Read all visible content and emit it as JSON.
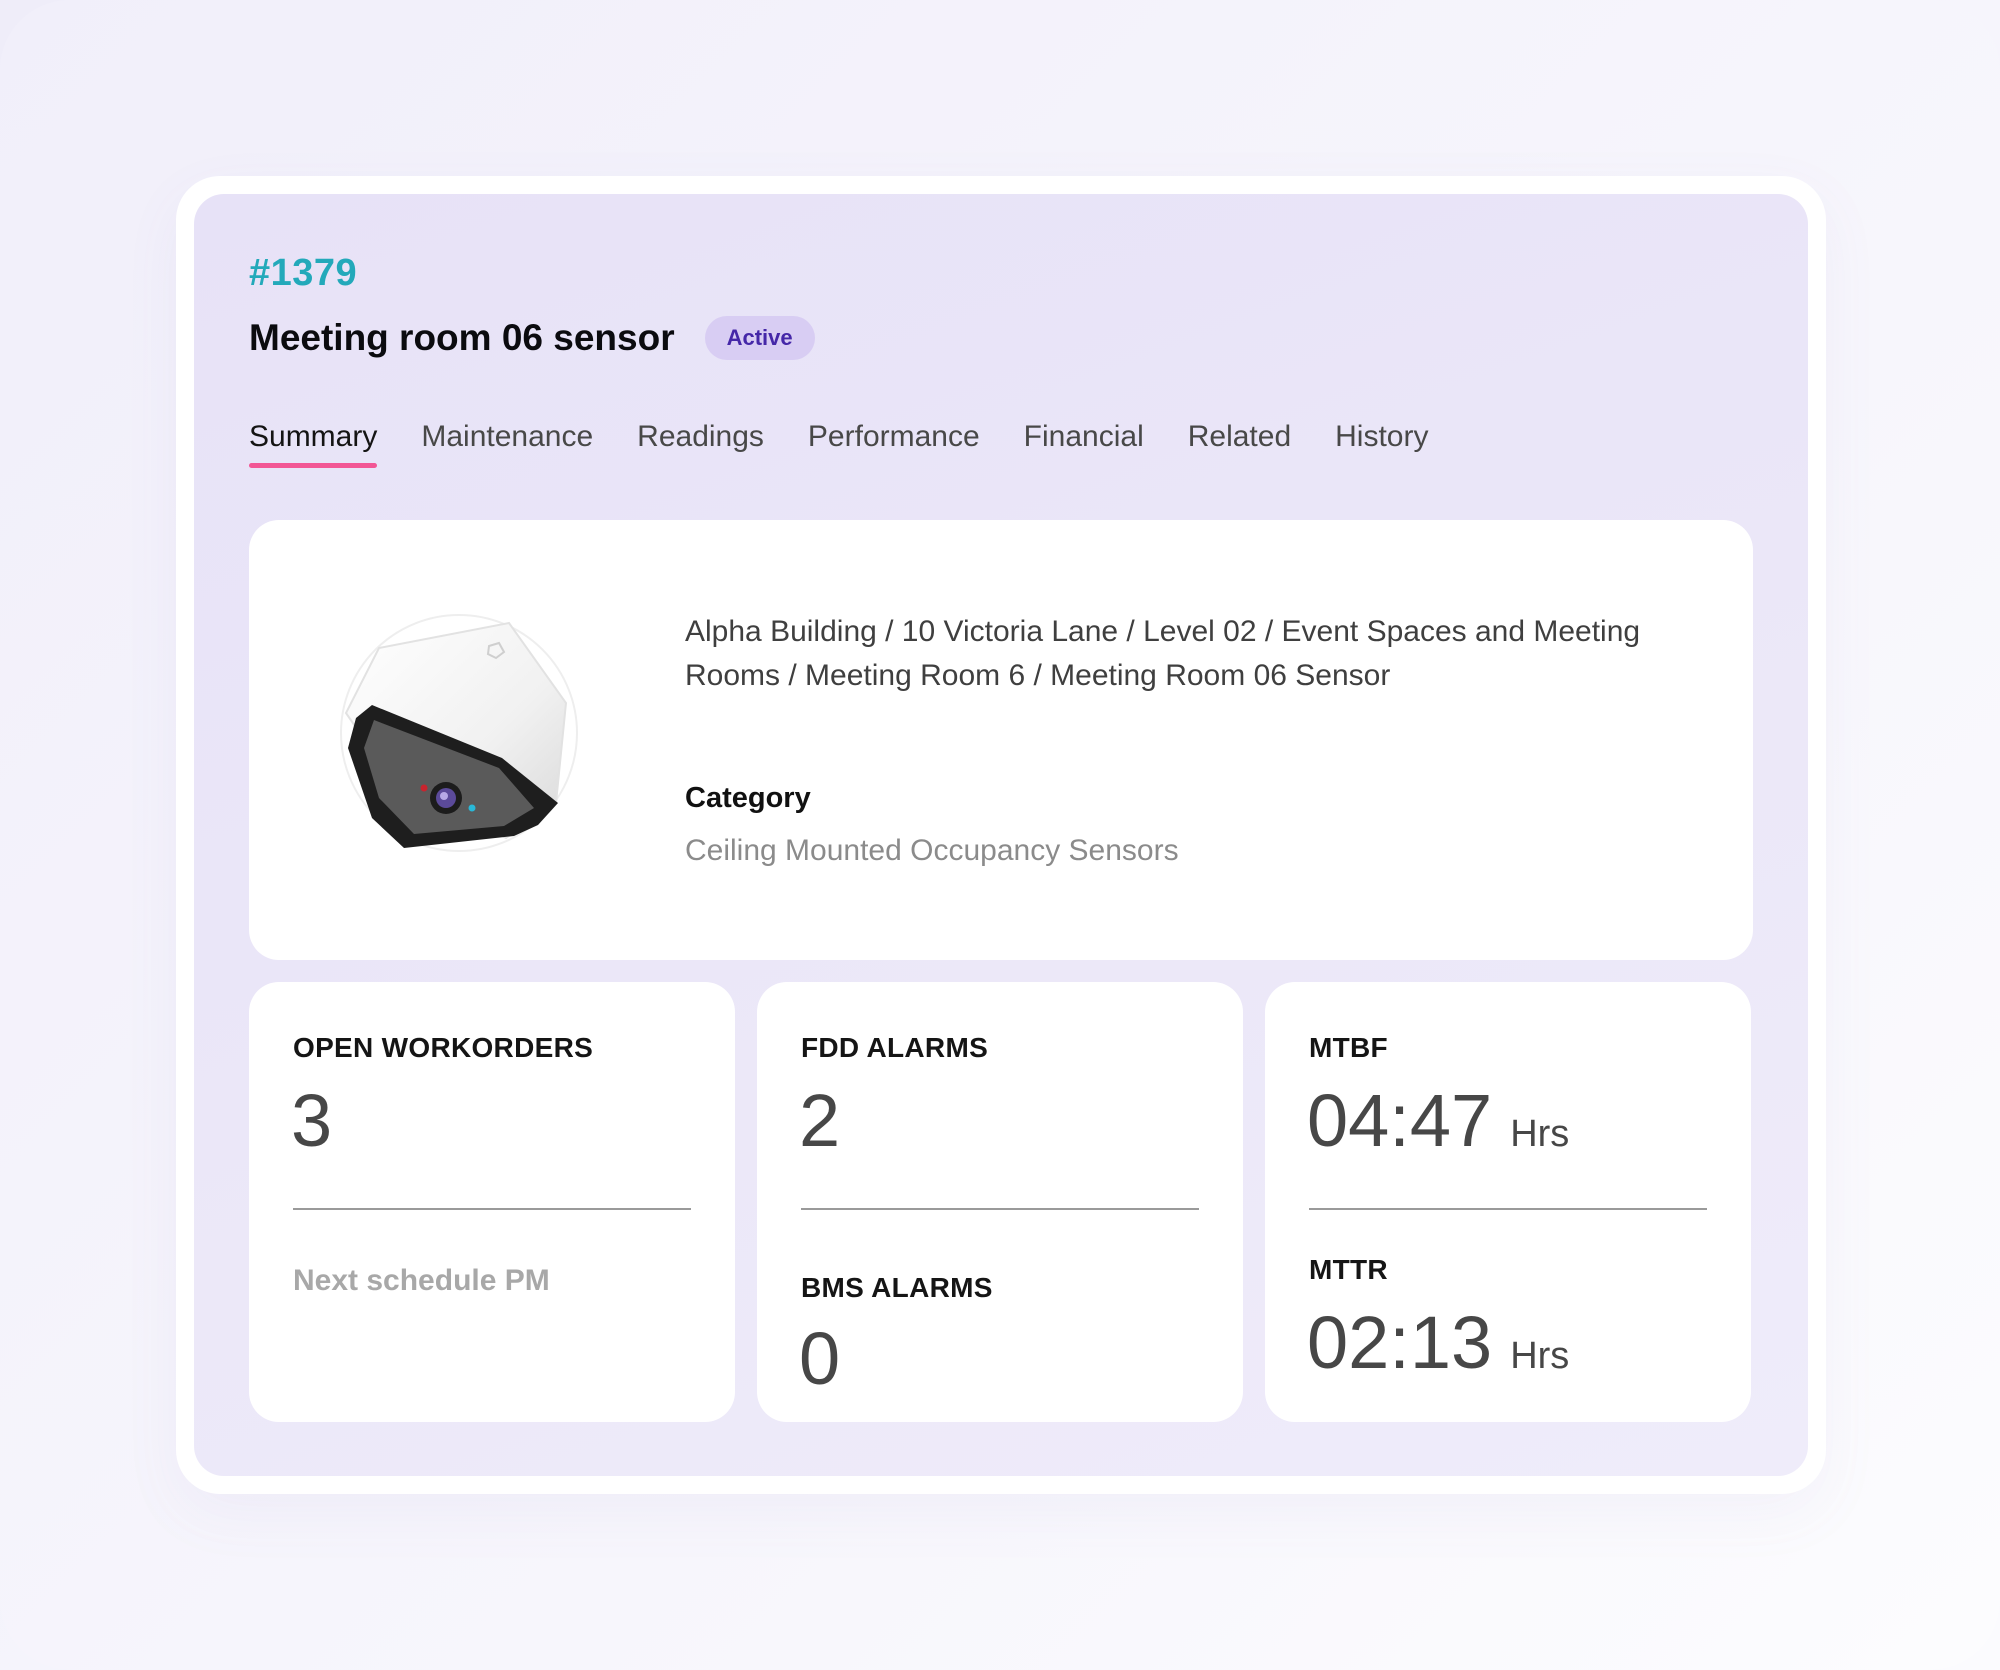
{
  "asset": {
    "id": "#1379",
    "title": "Meeting room 06 sensor",
    "status": "Active"
  },
  "tabs": [
    {
      "label": "Summary",
      "active": true
    },
    {
      "label": "Maintenance",
      "active": false
    },
    {
      "label": "Readings",
      "active": false
    },
    {
      "label": "Performance",
      "active": false
    },
    {
      "label": "Financial",
      "active": false
    },
    {
      "label": "Related",
      "active": false
    },
    {
      "label": "History",
      "active": false
    }
  ],
  "info": {
    "image_icon": "occupancy-sensor-device",
    "location_path": "Alpha Building / 10 Victoria Lane / Level 02 / Event Spaces and Meeting Rooms / Meeting Room 6 / Meeting Room 06 Sensor",
    "category_label": "Category",
    "category_value": "Ceiling Mounted Occupancy Sensors"
  },
  "stats": {
    "open_workorders": {
      "label": "OPEN WORKORDERS",
      "value": "3",
      "sub": "Next schedule PM"
    },
    "fdd_alarms": {
      "label": "FDD ALARMS",
      "value": "2"
    },
    "bms_alarms": {
      "label": "BMS ALARMS",
      "value": "0"
    },
    "mtbf": {
      "label": "MTBF",
      "value": "04:47",
      "unit": "Hrs"
    },
    "mttr": {
      "label": "MTTR",
      "value": "02:13",
      "unit": "Hrs"
    }
  },
  "colors": {
    "asset_id": "#23a9ba",
    "badge_bg": "#d8cdf3",
    "badge_text": "#4527a8",
    "tab_indicator": "#f25695",
    "panel_bg": "#e9e5f8"
  }
}
